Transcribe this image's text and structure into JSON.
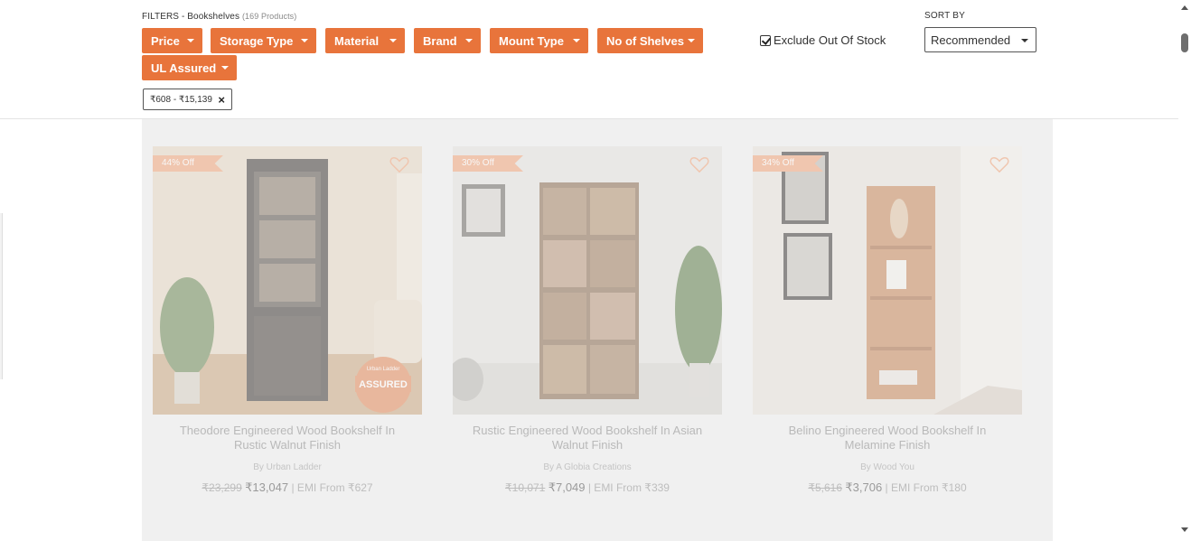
{
  "filters": {
    "label": "FILTERS - Bookshelves",
    "count": "(169 Products)",
    "chips": [
      {
        "label": "Price"
      },
      {
        "label": "Storage Type"
      },
      {
        "label": "Material"
      },
      {
        "label": "Brand"
      },
      {
        "label": "Mount Type"
      },
      {
        "label": "No of Shelves"
      },
      {
        "label": "UL Assured"
      }
    ],
    "applied": {
      "label": "₹608 - ₹15,139",
      "remove": "×"
    },
    "exclude_out_of_stock": {
      "label": "Exclude Out Of Stock",
      "checked": true
    }
  },
  "sort": {
    "label": "SORT BY",
    "value": "Recommended"
  },
  "colors": {
    "accent": "#e8743b",
    "badge": "#f0a47a",
    "grid_bg": "#f0f0f0"
  },
  "products": [
    {
      "badge": "44% Off",
      "title": "Theodore Engineered Wood Bookshelf In Rustic Walnut Finish",
      "brand": "By Urban Ladder",
      "mrp": "₹23,299",
      "price": "₹13,047",
      "emi": "| EMI From ₹627",
      "stamp": "ASSURED",
      "stamp_text": "Urban Ladder"
    },
    {
      "badge": "30% Off",
      "title": "Rustic Engineered Wood Bookshelf In Asian Walnut Finish",
      "brand": "By A Globia Creations",
      "mrp": "₹10,071",
      "price": "₹7,049",
      "emi": "| EMI From ₹339"
    },
    {
      "badge": "34% Off",
      "title": "Belino Engineered Wood Bookshelf In Melamine Finish",
      "brand": "By Wood You",
      "mrp": "₹5,616",
      "price": "₹3,706",
      "emi": "| EMI From ₹180"
    }
  ]
}
